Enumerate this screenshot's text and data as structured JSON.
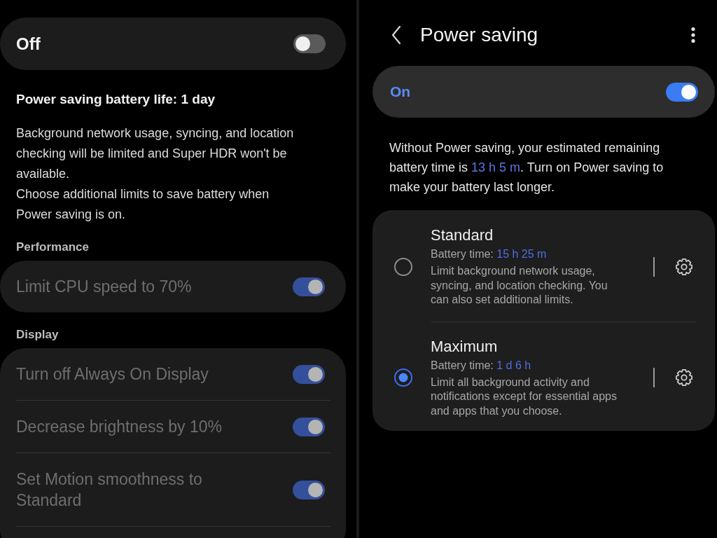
{
  "left_screen": {
    "master_switch": {
      "label": "Off",
      "on": false
    },
    "battery_life": "Power saving battery life: 1 day",
    "description": [
      "Background network usage, syncing, and location checking will be limited and Super HDR won't be available.",
      "Choose additional limits to save battery when Power saving is on."
    ],
    "sections": [
      {
        "title": "Performance",
        "items": [
          {
            "label": "Limit CPU speed to 70%",
            "on": true,
            "disabled": true
          }
        ]
      },
      {
        "title": "Display",
        "items": [
          {
            "label": "Turn off Always On Display",
            "on": true,
            "disabled": true
          },
          {
            "label": "Decrease brightness by 10%",
            "on": true,
            "disabled": true
          },
          {
            "label": "Set Motion smoothness to Standard",
            "on": true,
            "disabled": true
          }
        ]
      }
    ]
  },
  "right_screen": {
    "header": {
      "title": "Power saving"
    },
    "master_switch": {
      "label": "On",
      "on": true
    },
    "description": {
      "text_before": "Without Power saving, your estimated remaining battery time is",
      "estimate": "13 h 5 m",
      "text_after": ". Turn on Power saving to make your battery last longer."
    },
    "modes": [
      {
        "title": "Standard",
        "battery_time_label": "Battery time:",
        "battery_time": "15 h 25 m",
        "description": "Limit background network usage, syncing, and location checking. You can also set additional limits.",
        "selected": false
      },
      {
        "title": "Maximum",
        "battery_time_label": "Battery time:",
        "battery_time": "1 d 6 h",
        "description": "Limit all background activity and notifications except for essential apps and apps that you choose.",
        "selected": true
      }
    ]
  }
}
